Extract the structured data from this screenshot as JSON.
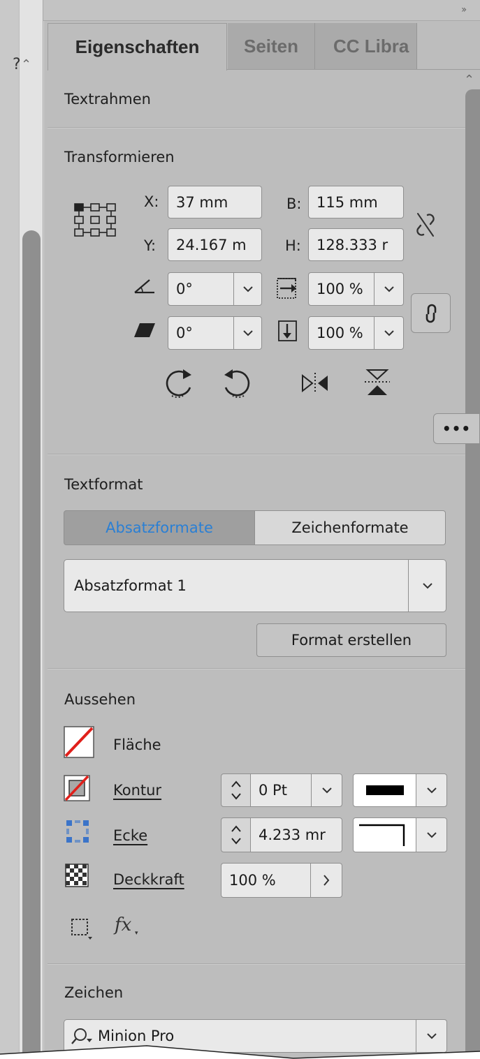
{
  "left_strip": {
    "partial_glyph": "?",
    "up_arrow": "⌃"
  },
  "tabs": [
    {
      "label": "Eigenschaften",
      "active": true
    },
    {
      "label": "Seiten",
      "active": false
    },
    {
      "label": "CC Libra",
      "active": false
    }
  ],
  "panel_menu_glyph": "››",
  "textrahmen": {
    "title": "Textrahmen"
  },
  "transform": {
    "title": "Transformieren",
    "x_label": "X:",
    "x_value": "37 mm",
    "y_label": "Y:",
    "y_value": "24.167 m",
    "w_label": "B:",
    "w_value": "115 mm",
    "h_label": "H:",
    "h_value": "128.333 r",
    "rotation_value": "0°",
    "shear_value": "0°",
    "scale_x_value": "100 %",
    "scale_y_value": "100 %",
    "more_glyph": "•••"
  },
  "textformat": {
    "title": "Textformat",
    "tab_paragraph": "Absatzformate",
    "tab_character": "Zeichenformate",
    "selected_style": "Absatzformat 1",
    "create_button": "Format erstellen"
  },
  "aussehen": {
    "title": "Aussehen",
    "fill_label": "Fläche",
    "stroke_label": "Kontur",
    "stroke_weight": "0 Pt",
    "corner_label": "Ecke",
    "corner_value": "4.233 mr",
    "opacity_label": "Deckkraft",
    "opacity_value": "100 %",
    "fx_glyph": "fx"
  },
  "zeichen": {
    "title": "Zeichen",
    "font_value": "Minion Pro"
  },
  "colors": {
    "panel_bg": "#bdbdbd",
    "field_bg": "#e9e9e9",
    "accent_blue": "#2a7fd4",
    "fill_none_red": "#e0201b"
  }
}
